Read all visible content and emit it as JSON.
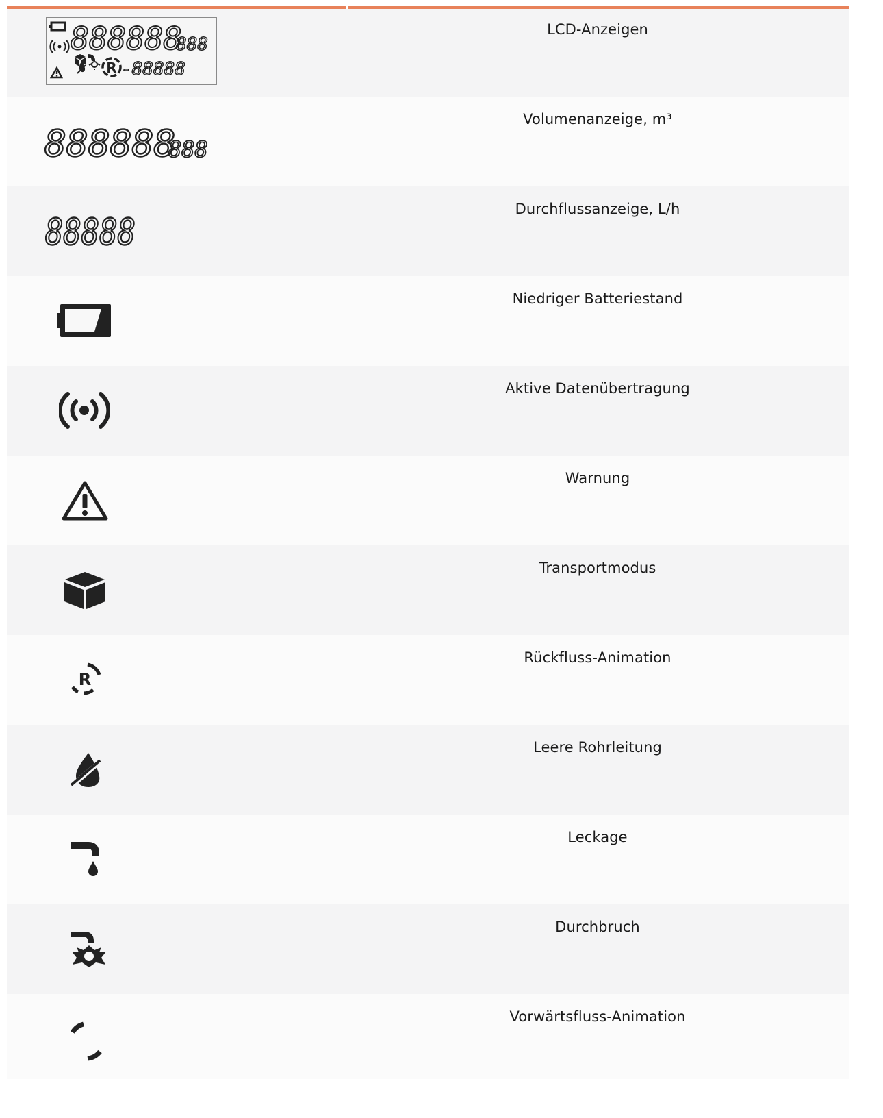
{
  "accent": "#e8825a",
  "rows": [
    {
      "label": "LCD-Anzeigen",
      "icon": "lcd-display-overview-icon"
    },
    {
      "label": "Volumenanzeige, m³",
      "icon": "volume-display-digits-icon"
    },
    {
      "label": "Durchflussanzeige, L/h",
      "icon": "flow-display-digits-icon"
    },
    {
      "label": "Niedriger Batteriestand",
      "icon": "low-battery-icon"
    },
    {
      "label": "Aktive Datenübertragung",
      "icon": "radio-transmission-icon"
    },
    {
      "label": "Warnung",
      "icon": "warning-triangle-icon"
    },
    {
      "label": "Transportmodus",
      "icon": "transport-box-icon"
    },
    {
      "label": "Rückfluss-Animation",
      "icon": "backflow-animation-icon"
    },
    {
      "label": "Leere Rohrleitung",
      "icon": "empty-pipe-icon"
    },
    {
      "label": "Leckage",
      "icon": "leakage-icon"
    },
    {
      "label": "Durchbruch",
      "icon": "burst-icon"
    },
    {
      "label": "Vorwärtsfluss-Animation",
      "icon": "forward-flow-animation-icon"
    }
  ],
  "lcd": {
    "volume_digits": "888888",
    "volume_decimals": "888",
    "flow_digits": "88888",
    "lower_digits": "-88888"
  }
}
